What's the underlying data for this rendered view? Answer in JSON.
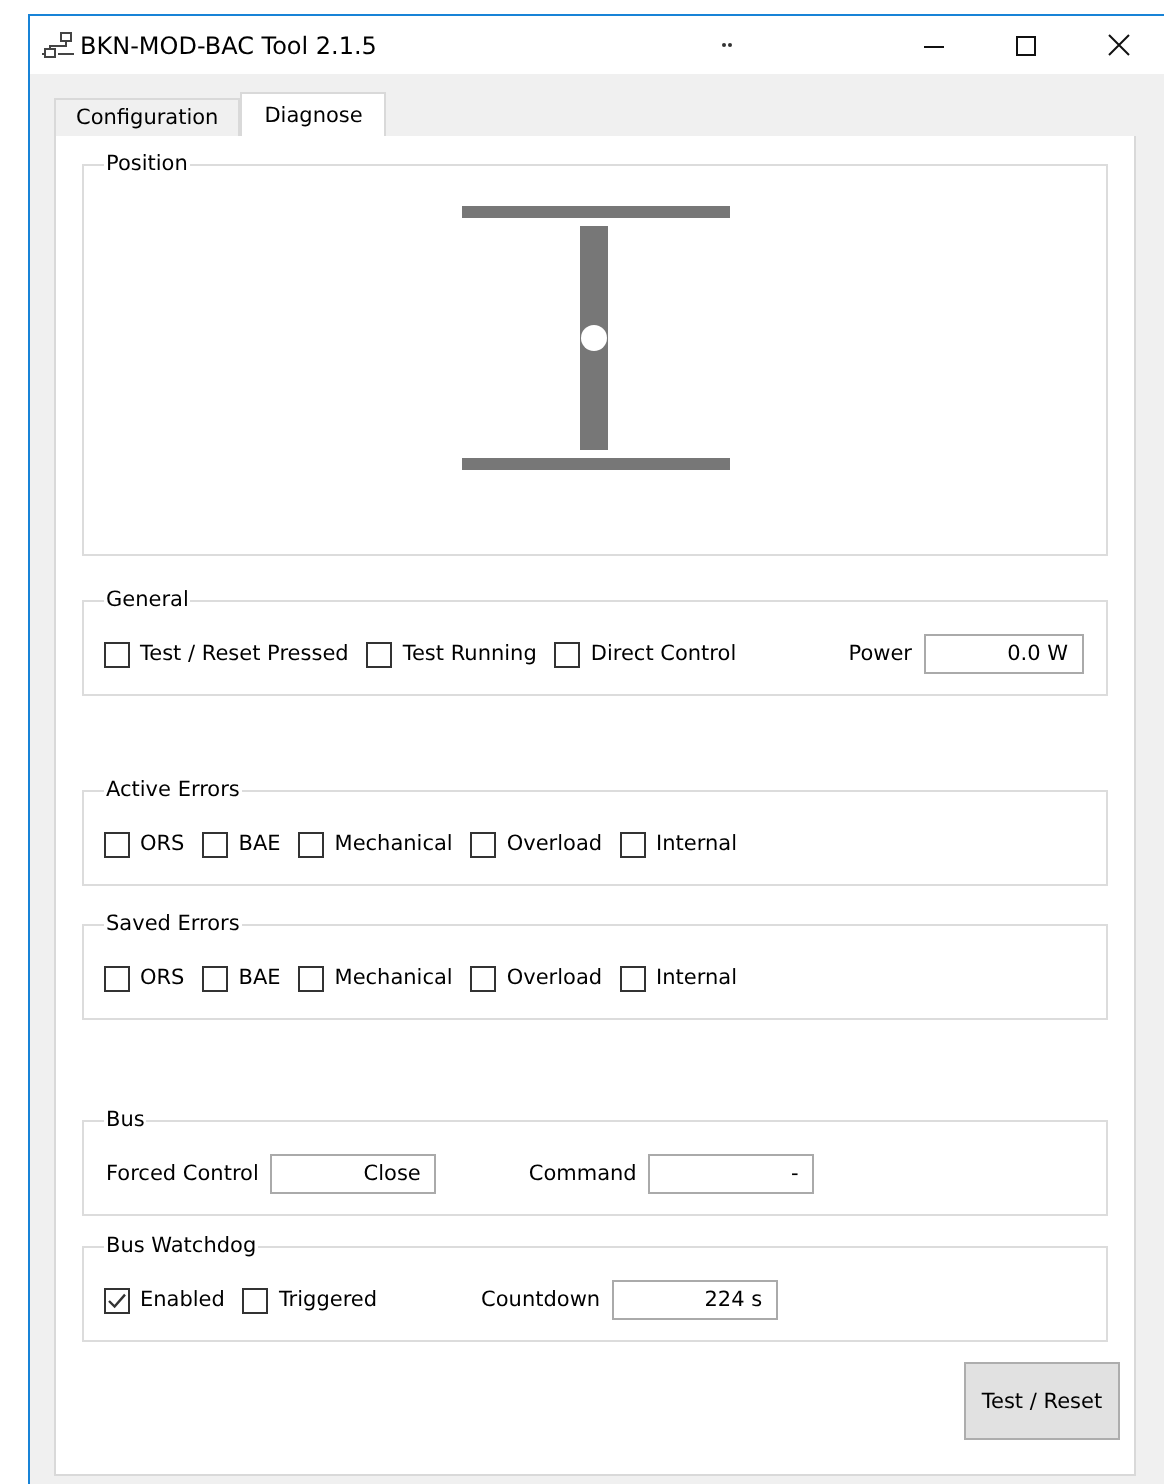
{
  "window": {
    "title": "BKN-MOD-BAC Tool 2.1.5"
  },
  "tabs": [
    {
      "label": "Configuration",
      "selected": false
    },
    {
      "label": "Diagnose",
      "selected": true
    }
  ],
  "position": {
    "title": "Position",
    "level": 0.5
  },
  "general": {
    "title": "General",
    "checks": [
      {
        "label": "Test / Reset Pressed",
        "checked": false
      },
      {
        "label": "Test Running",
        "checked": false
      },
      {
        "label": "Direct Control",
        "checked": false
      }
    ],
    "power": {
      "label": "Power",
      "value": "0.0 W"
    }
  },
  "active_errors": {
    "title": "Active Errors",
    "checks": [
      {
        "label": "ORS",
        "checked": false
      },
      {
        "label": "BAE",
        "checked": false
      },
      {
        "label": "Mechanical",
        "checked": false
      },
      {
        "label": "Overload",
        "checked": false
      },
      {
        "label": "Internal",
        "checked": false
      }
    ]
  },
  "saved_errors": {
    "title": "Saved Errors",
    "checks": [
      {
        "label": "ORS",
        "checked": false
      },
      {
        "label": "BAE",
        "checked": false
      },
      {
        "label": "Mechanical",
        "checked": false
      },
      {
        "label": "Overload",
        "checked": false
      },
      {
        "label": "Internal",
        "checked": false
      }
    ]
  },
  "bus": {
    "title": "Bus",
    "fields": [
      {
        "label": "Forced Control",
        "value": "Close"
      },
      {
        "label": "Command",
        "value": "-"
      }
    ]
  },
  "bus_watchdog": {
    "title": "Bus Watchdog",
    "checks": [
      {
        "label": "Enabled",
        "checked": true
      },
      {
        "label": "Triggered",
        "checked": false
      }
    ],
    "countdown": {
      "label": "Countdown",
      "value": "224 s"
    }
  },
  "buttons": [
    "Test / Reset"
  ]
}
